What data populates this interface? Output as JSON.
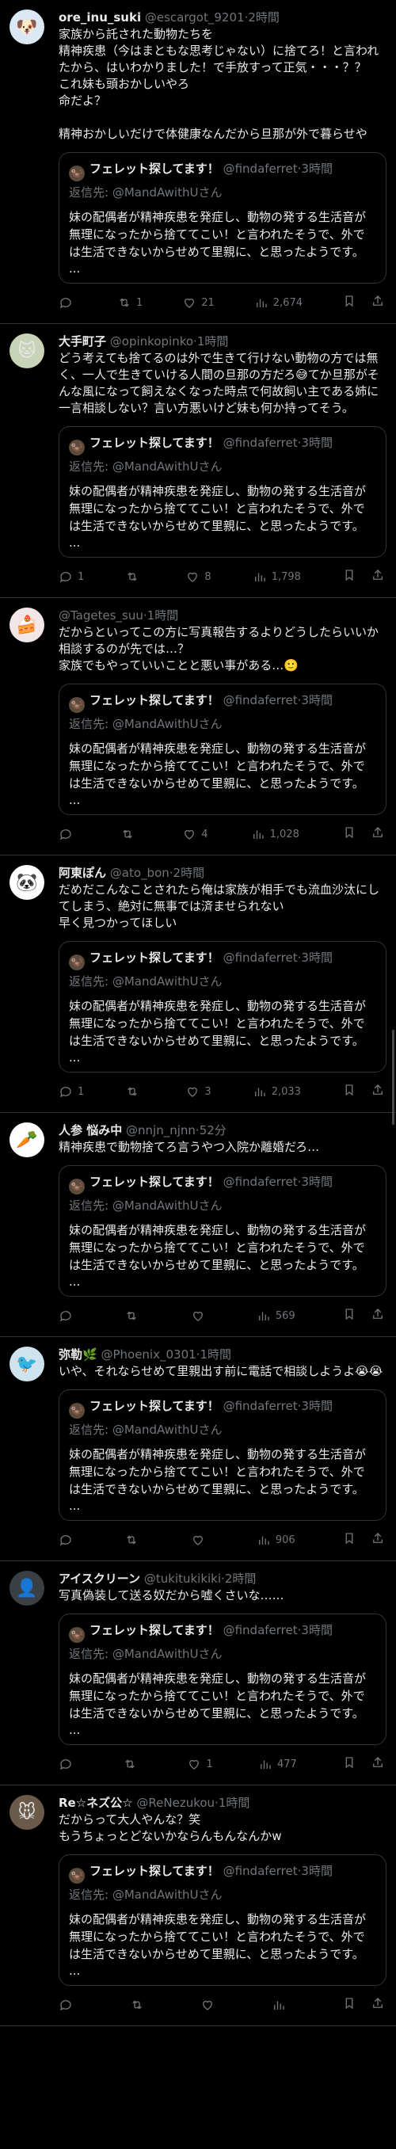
{
  "quoted": {
    "name": "フェレット探してます！",
    "handle": "@findaferret",
    "time": "3時間",
    "reply_to": "返信先: @MandAwithUさん",
    "body": "妹の配偶者が精神疾患を発症し、動物の発する生活音が無理になったから捨ててこい！と言われたそうで、外では生活できないからせめて里親に、と思ったようです。",
    "more": "..."
  },
  "tweets": [
    {
      "name": "ore_inu_suki",
      "handle": "@escargot_9201",
      "time": "2時間",
      "text": "家族から託された動物たちを\n精神疾患（今はまともな思考じゃない）に捨てろ！と言われたから、はいわかりました！で手放すって正気・・・？？\nこれ妹も頭おかしいやろ\n命だよ？\n\n精神おかしいだけで体健康なんだから旦那が外で暮らせや",
      "replies": "",
      "retweets": "1",
      "likes": "21",
      "views": "2,674",
      "avatar_color": "#d9e8f2",
      "avatar_glyph": "🐶"
    },
    {
      "name": "大手町子",
      "handle": "@opinkopinko",
      "time": "1時間",
      "text": "どう考えても捨てるのは外で生きて行けない動物の方では無く、一人で生きていける人間の旦那の方だろ😅てか旦那がそんな風になって飼えなくなった時点で何故飼い主である姉に一言相談しない？言い方悪いけど妹も何か持ってそう。",
      "replies": "1",
      "retweets": "",
      "likes": "8",
      "views": "1,798",
      "avatar_color": "#c9d3b8",
      "avatar_glyph": "🐱"
    },
    {
      "name": "",
      "handle": "@Tagetes_suu",
      "time": "1時間",
      "text": "だからといってこの方に写真報告するよりどうしたらいいか相談するのが先では…？\n家族でもやっていいことと悪い事がある…🙂",
      "replies": "",
      "retweets": "",
      "likes": "4",
      "views": "1,028",
      "avatar_color": "#f2e6e6",
      "avatar_glyph": "🍰"
    },
    {
      "name": "阿東ぽん",
      "handle": "@ato_bon",
      "time": "2時間",
      "text": "だめだこんなことされたら俺は家族が相手でも流血沙汰にしてしまう、絶対に無事では済ませられない\n早く見つかってほしい",
      "replies": "1",
      "retweets": "",
      "likes": "3",
      "views": "2,033",
      "avatar_color": "#ffffff",
      "avatar_glyph": "🐼"
    },
    {
      "name": "人参 悩み中",
      "handle": "@nnjn_njnn",
      "time": "52分",
      "text": "精神疾患で動物捨てろ言うやつ入院か離婚だろ…",
      "replies": "",
      "retweets": "",
      "likes": "",
      "views": "569",
      "avatar_color": "#ffffff",
      "avatar_glyph": "🥕"
    },
    {
      "name": "弥勒🌿",
      "handle": "@Phoenix_0301",
      "time": "1時間",
      "text": "いや、それならせめて里親出す前に電話で相談しようよ😭😭",
      "replies": "",
      "retweets": "",
      "likes": "",
      "views": "906",
      "avatar_color": "#cfe3ee",
      "avatar_glyph": "🐦"
    },
    {
      "name": "アイスクリーン",
      "handle": "@tukitukikiki",
      "time": "2時間",
      "text": "写真偽装して送る奴だから嘘くさいな……",
      "replies": "",
      "retweets": "",
      "likes": "1",
      "views": "477",
      "avatar_color": "#3a3f44",
      "avatar_glyph": "👤"
    },
    {
      "name": "Re☆ネズ公☆",
      "handle": "@ReNezukou",
      "time": "1時間",
      "text": "だからって大人やんな？笑\nもうちょっとどないかならんもんなんかw",
      "replies": "",
      "retweets": "",
      "likes": "",
      "views": "",
      "avatar_color": "#6b5a4a",
      "avatar_glyph": "🐭"
    }
  ]
}
